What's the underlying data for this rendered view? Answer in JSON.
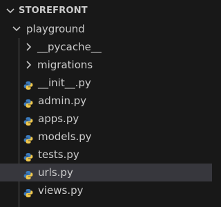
{
  "explorer": {
    "root": {
      "label": "STOREFRONT",
      "icon": "chevron-down-icon",
      "expanded": true
    },
    "folder": {
      "label": "playground",
      "icon": "chevron-down-icon",
      "expanded": true
    },
    "items": [
      {
        "label": "__pycache__",
        "type": "folder",
        "icon": "chevron-right-icon"
      },
      {
        "label": "migrations",
        "type": "folder",
        "icon": "chevron-right-icon"
      },
      {
        "label": "__init__.py",
        "type": "file",
        "icon": "python-icon"
      },
      {
        "label": "admin.py",
        "type": "file",
        "icon": "python-icon"
      },
      {
        "label": "apps.py",
        "type": "file",
        "icon": "python-icon"
      },
      {
        "label": "models.py",
        "type": "file",
        "icon": "python-icon"
      },
      {
        "label": "tests.py",
        "type": "file",
        "icon": "python-icon"
      },
      {
        "label": "urls.py",
        "type": "file",
        "icon": "python-icon",
        "selected": true
      },
      {
        "label": "views.py",
        "type": "file",
        "icon": "python-icon"
      }
    ]
  },
  "colors": {
    "background": "#181818",
    "text": "#cccccc",
    "selection": "#37373d",
    "chevron": "#c5c5c5",
    "python_blue": "#3b7bbf",
    "python_yellow": "#f2c94c"
  }
}
